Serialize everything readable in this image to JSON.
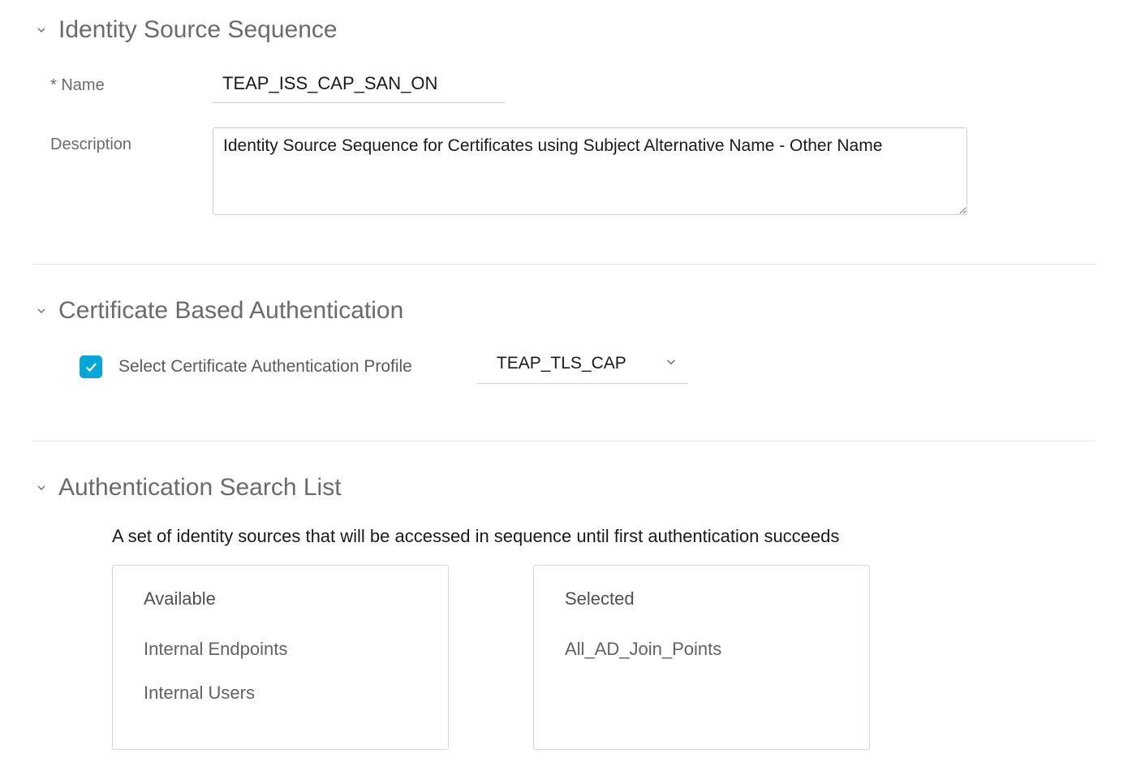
{
  "section1": {
    "title": "Identity Source Sequence",
    "name_label": "* Name",
    "name_value": "TEAP_ISS_CAP_SAN_ON",
    "description_label": "Description",
    "description_value": "Identity Source Sequence for Certificates using Subject Alternative Name - Other Name"
  },
  "section2": {
    "title": "Certificate Based Authentication",
    "checkbox_label": "Select Certificate Authentication Profile",
    "dropdown_value": "TEAP_TLS_CAP"
  },
  "section3": {
    "title": "Authentication Search List",
    "description": "A set of identity sources that will be accessed in sequence until first authentication succeeds",
    "available_title": "Available",
    "selected_title": "Selected",
    "available_items": [
      "Internal Endpoints",
      "Internal Users"
    ],
    "selected_items": [
      "All_AD_Join_Points"
    ]
  }
}
